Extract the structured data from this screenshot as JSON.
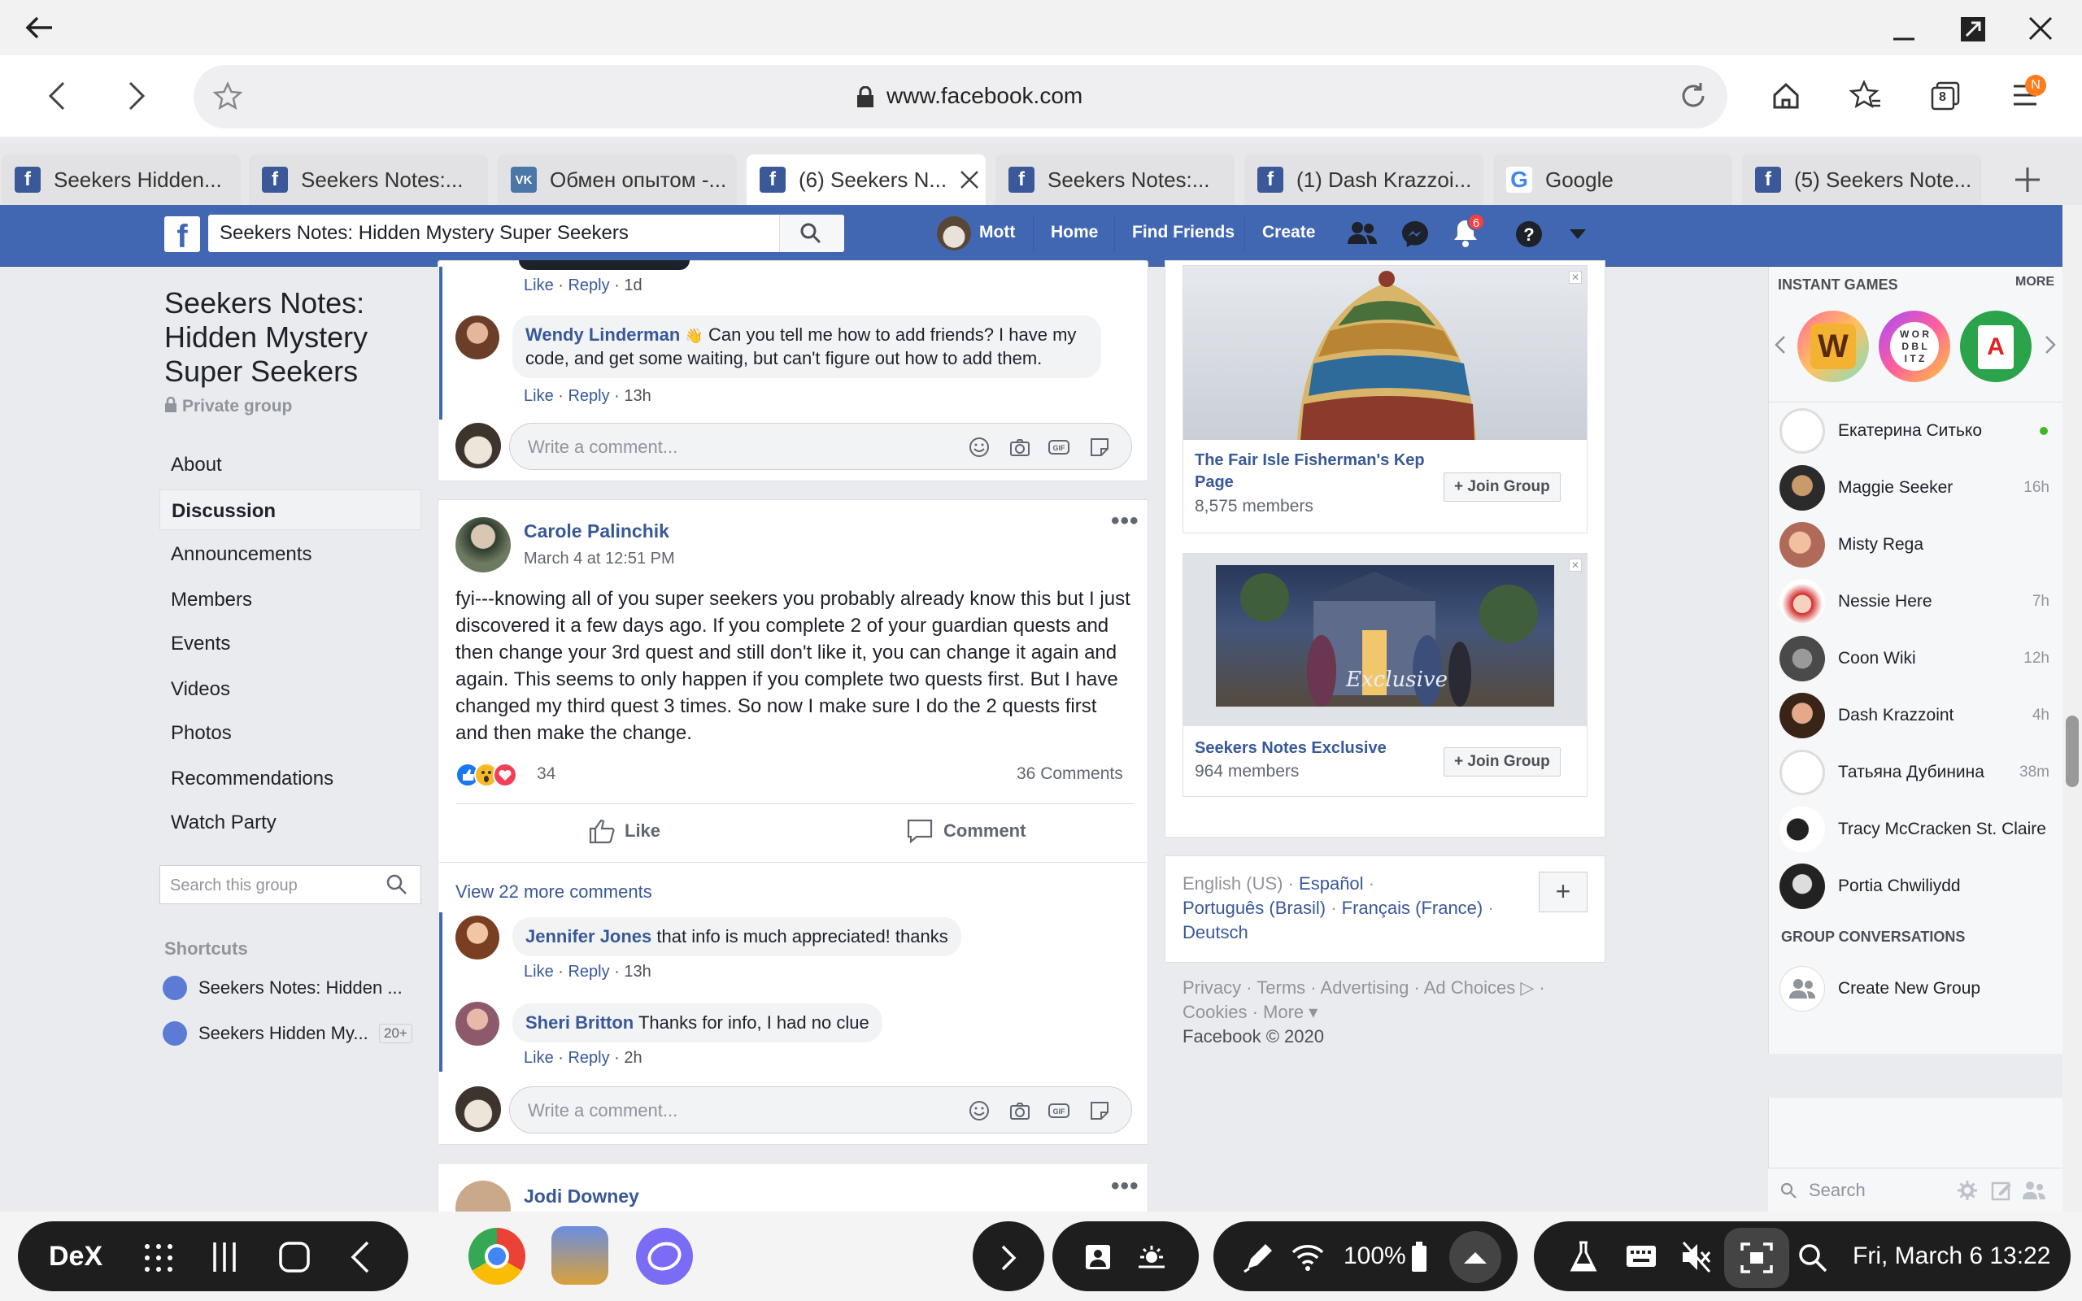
{
  "browser": {
    "url": "www.facebook.com",
    "menu_badge": "N",
    "tab_count": "8",
    "tabs": [
      {
        "title": "Seekers Hidden...",
        "icon": "facebook-icon"
      },
      {
        "title": "Seekers Notes:...",
        "icon": "facebook-icon"
      },
      {
        "title": "Обмен опытом -...",
        "icon": "vk-icon"
      },
      {
        "title": "(6) Seekers N...",
        "icon": "facebook-icon",
        "active": true
      },
      {
        "title": "Seekers Notes:...",
        "icon": "facebook-icon"
      },
      {
        "title": "(1) Dash Krazzoi...",
        "icon": "facebook-icon"
      },
      {
        "title": "Google",
        "icon": "google-icon"
      },
      {
        "title": "(5) Seekers Note...",
        "icon": "facebook-icon"
      }
    ]
  },
  "fb_header": {
    "search_value": "Seekers Notes: Hidden Mystery Super Seekers",
    "user": "Mott",
    "home": "Home",
    "find_friends": "Find Friends",
    "create": "Create",
    "notif_count": "6"
  },
  "group": {
    "title": "Seekers Notes: Hidden Mystery Super Seekers",
    "privacy": "Private group",
    "nav": [
      "About",
      "Discussion",
      "Announcements",
      "Members",
      "Events",
      "Videos",
      "Photos",
      "Recommendations",
      "Watch Party"
    ],
    "search_placeholder": "Search this group",
    "shortcuts_heading": "Shortcuts",
    "shortcuts": [
      {
        "label": "Seekers Notes: Hidden ...",
        "badge": ""
      },
      {
        "label": "Seekers Hidden My...",
        "badge": "20+"
      }
    ]
  },
  "feed": {
    "top_meta": {
      "like": "Like",
      "reply": "Reply",
      "time": "1d"
    },
    "wendy": {
      "name": "Wendy Linderman",
      "text": "Can you tell me how to add friends? I have my code, and get some waiting, but can't figure out how to add them.",
      "like": "Like",
      "reply": "Reply",
      "time": "13h"
    },
    "write_placeholder": "Write a comment...",
    "post": {
      "author": "Carole Palinchik",
      "date": "March 4 at 12:51 PM",
      "body": "fyi---knowing all of you super seekers you probably already know this but I just discovered it a few days ago. If you complete 2 of your guardian quests and then change your 3rd quest and still don't like it, you can change it again and again. This seems to only happen if you complete two quests first. But I have changed my third quest 3 times. So now I make sure I do the 2 quests first and then make the change.",
      "reactions": "34",
      "comments_count": "36 Comments",
      "like_btn": "Like",
      "comment_btn": "Comment",
      "view_more": "View 22 more comments"
    },
    "comments": [
      {
        "name": "Jennifer Jones",
        "text": "that info is much appreciated! thanks",
        "like": "Like",
        "reply": "Reply",
        "time": "13h"
      },
      {
        "name": "Sheri Britton",
        "text": "Thanks for info, I had no clue",
        "like": "Like",
        "reply": "Reply",
        "time": "2h"
      }
    ],
    "next_post_author": "Jodi Downey"
  },
  "ads": [
    {
      "title": "The Fair Isle Fisherman's Kep Page",
      "members": "8,575 members",
      "button": "Join Group"
    },
    {
      "title": "Seekers Notes Exclusive",
      "members": "964 members",
      "button": "Join Group",
      "image_caption": "Exclusive"
    }
  ],
  "footer": {
    "languages": [
      "English (US)",
      "Español",
      "Português (Brasil)",
      "Français (France)",
      "Deutsch"
    ],
    "links": [
      "Privacy",
      "Terms",
      "Advertising",
      "Ad Choices",
      "Cookies",
      "More"
    ],
    "copyright": "Facebook © 2020"
  },
  "chat": {
    "instant_games": "INSTANT GAMES",
    "more": "MORE",
    "contacts": [
      {
        "name": "Екатерина Ситько",
        "time": "",
        "online": true
      },
      {
        "name": "Maggie Seeker",
        "time": "16h"
      },
      {
        "name": "Misty Rega",
        "time": ""
      },
      {
        "name": "Nessie Here",
        "time": "7h"
      },
      {
        "name": "Coon Wiki",
        "time": "12h"
      },
      {
        "name": "Dash Krazzoint",
        "time": "4h"
      },
      {
        "name": "Татьяна Дубинина",
        "time": "38m"
      },
      {
        "name": "Tracy McCracken St. Claire",
        "time": ""
      },
      {
        "name": "Portia Chwiliydd",
        "time": ""
      }
    ],
    "group_conversations": "GROUP CONVERSATIONS",
    "create_group": "Create New Group",
    "search_placeholder": "Search"
  },
  "taskbar": {
    "dex": "DeX",
    "battery": "100%",
    "datetime": "Fri, March 6 13:22"
  }
}
